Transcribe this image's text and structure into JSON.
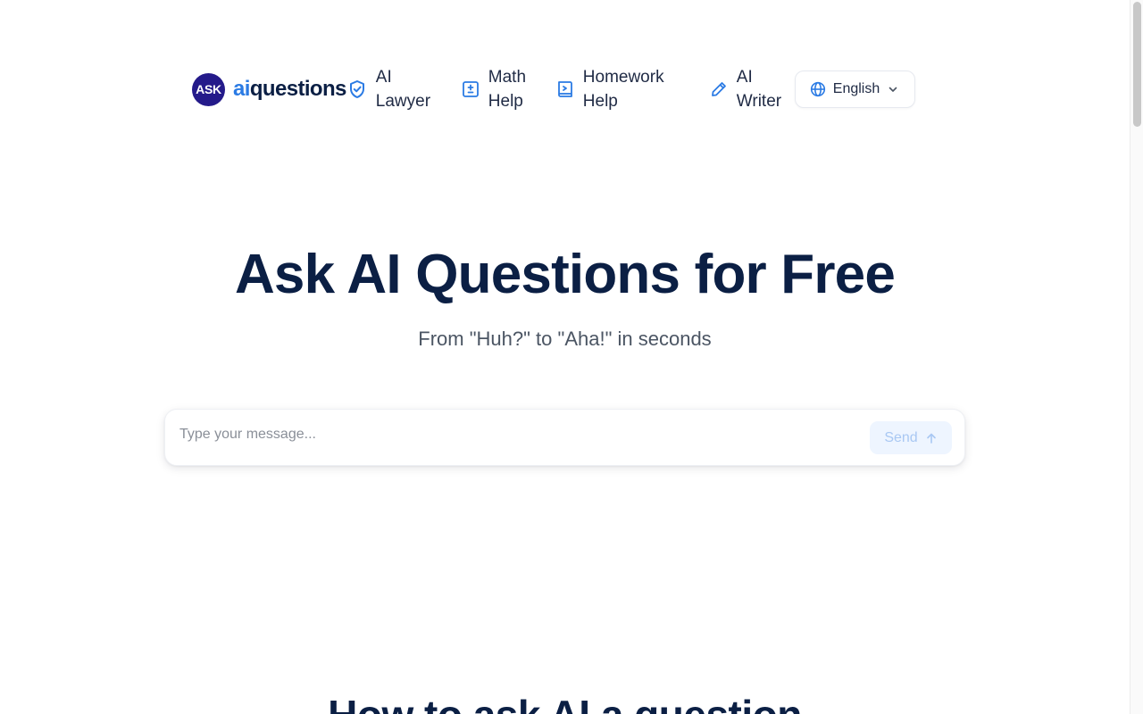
{
  "brand": {
    "badge_text": "ASK",
    "name_prefix": "ai",
    "name_suffix": "questions",
    "badge_color": "#241a8a",
    "accent_color": "#2b7be4"
  },
  "nav": {
    "items": [
      {
        "label": "AI Lawyer",
        "icon": "shield-check-icon"
      },
      {
        "label": "Math Help",
        "icon": "calculator-icon"
      },
      {
        "label": "Homework Help",
        "icon": "book-icon"
      },
      {
        "label": "AI Writer",
        "icon": "pencil-icon"
      }
    ],
    "language": {
      "selected": "English",
      "icon": "globe-icon"
    }
  },
  "hero": {
    "title": "Ask AI Questions for Free",
    "subtitle": "From \"Huh?\" to \"Aha!\" in seconds"
  },
  "chat": {
    "placeholder": "Type your message...",
    "value": "",
    "send_label": "Send"
  },
  "section": {
    "title": "How to ask AI a question"
  },
  "colors": {
    "text_dark": "#0b1f44",
    "send_bg": "#eef5ff",
    "send_text": "#a9c8f3"
  }
}
